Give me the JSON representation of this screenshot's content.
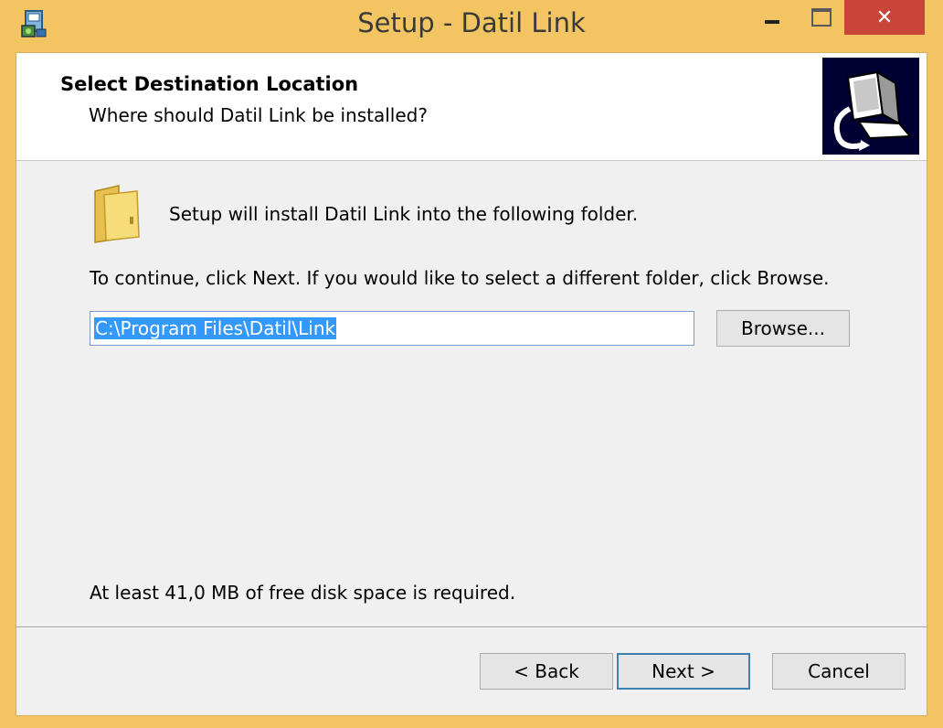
{
  "window": {
    "title": "Setup - Datil Link",
    "close_glyph": "✕"
  },
  "header": {
    "title": "Select Destination Location",
    "subtitle": "Where should Datil Link be installed?"
  },
  "main": {
    "intro_text": "Setup will install Datil Link into the following folder.",
    "instructions": "To continue, click Next. If you would like to select a different folder, click Browse.",
    "path_value": "C:\\Program Files\\Datil\\Link",
    "browse_label": "Browse...",
    "disk_space": "At least 41,0 MB of free disk space is required."
  },
  "footer": {
    "back_label": "< Back",
    "next_label": "Next >",
    "cancel_label": "Cancel"
  },
  "icons": {
    "app": "setup-icon",
    "folder": "folder-icon",
    "wizard": "computer-install-icon"
  },
  "colors": {
    "frame": "#f2c462",
    "close_button": "#c9453a",
    "selection": "#3399ff",
    "wizard_image_bg": "#000033"
  }
}
